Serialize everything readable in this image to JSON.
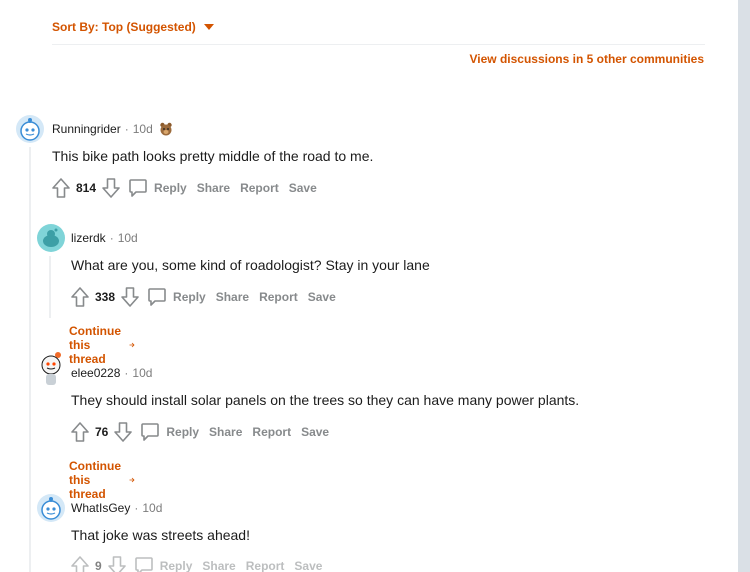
{
  "sort": {
    "label": "Sort By: Top (Suggested)"
  },
  "view_discussions": "View discussions in 5 other communities",
  "actions": {
    "reply": "Reply",
    "share": "Share",
    "report": "Report",
    "save": "Save"
  },
  "continue_thread": "Continue this thread",
  "colors": {
    "accent": "#d35400",
    "muted": "#878a8c",
    "text": "#1c1c1c",
    "line": "#edeff1"
  },
  "comments": [
    {
      "user": "Runningrider",
      "time": "10d",
      "text": "This bike path looks pretty middle of the road to me.",
      "score": "814",
      "award_icon": "award-bear-icon"
    },
    {
      "user": "lizerdk",
      "time": "10d",
      "text": "What are you, some kind of roadologist? Stay in your lane",
      "score": "338"
    },
    {
      "user": "elee0228",
      "time": "10d",
      "text": "They should install solar panels on the trees so they can have many power plants.",
      "score": "76"
    },
    {
      "user": "WhatIsGey",
      "time": "10d",
      "text": "That joke was streets ahead!",
      "score": "9"
    }
  ]
}
